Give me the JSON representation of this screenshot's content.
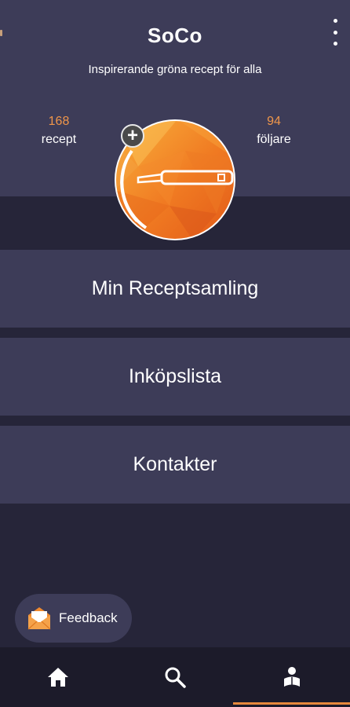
{
  "app": {
    "title": "SoCo",
    "subtitle": "Inspirerande gröna recept för alla"
  },
  "profile": {
    "stats": [
      {
        "value": "168",
        "label": "recept"
      },
      {
        "value": "94",
        "label": "följare"
      }
    ],
    "add_symbol": "+"
  },
  "menu": {
    "items": [
      {
        "label": "Min Receptsamling"
      },
      {
        "label": "Inköpslista"
      },
      {
        "label": "Kontakter"
      }
    ]
  },
  "feedback": {
    "label": "Feedback",
    "icon": "envelope-icon"
  },
  "bottom_nav": {
    "items": [
      {
        "icon": "home-icon",
        "active": false
      },
      {
        "icon": "search-icon",
        "active": false
      },
      {
        "icon": "profile-reader-icon",
        "active": true
      }
    ]
  },
  "colors": {
    "background": "#262539",
    "panel": "#3d3c58",
    "nav": "#1c1b2a",
    "accent": "#e5883c",
    "stat_number": "#f0964a"
  }
}
